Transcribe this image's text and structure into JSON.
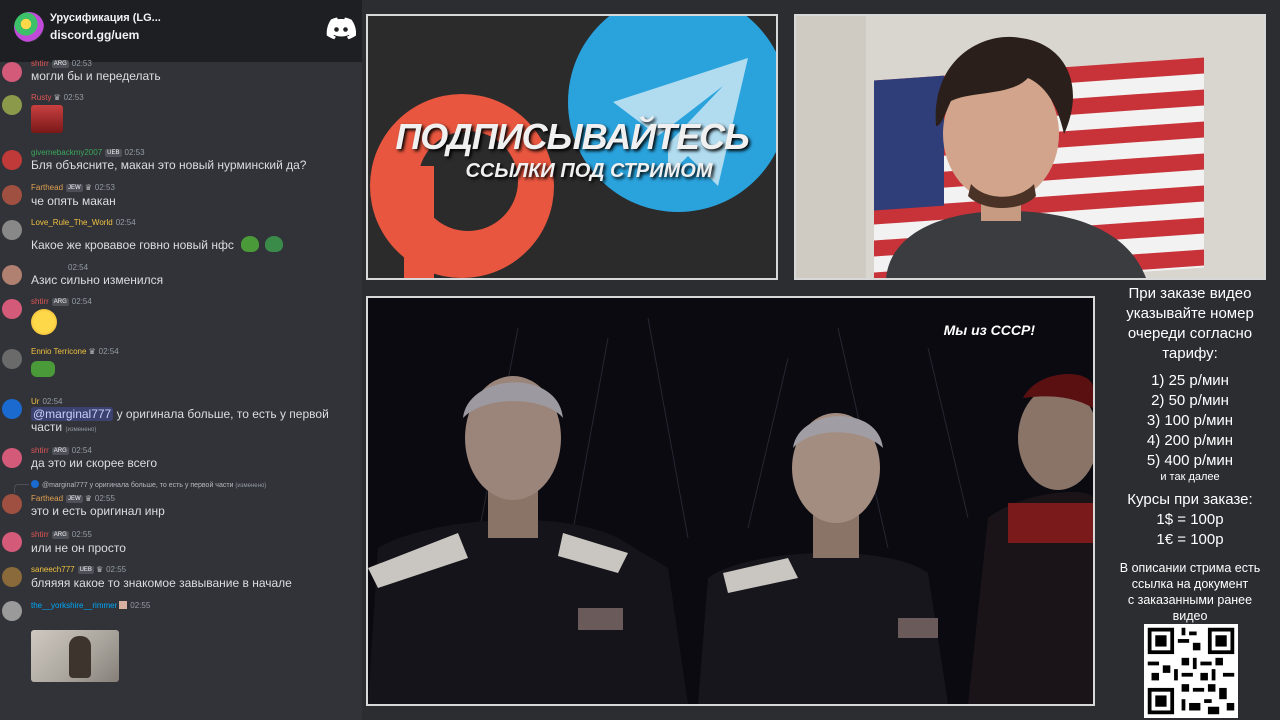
{
  "discord": {
    "server_name": "Урусификация (LG...",
    "invite": "discord.gg/uem",
    "messages": [
      {
        "author": "shtirr",
        "tag": "ARG",
        "time": "02:53",
        "text": "могли бы и переделать",
        "author_color": "#e05656"
      },
      {
        "author": "Rusty",
        "time": "02:53",
        "author_color": "#e05656"
      },
      {
        "author": "givemebackmy2007",
        "tag": "UEB",
        "time": "02:53",
        "text": "Бля объясните, макан это новый нурминский да?",
        "author_color": "#3ba55c"
      },
      {
        "author": "Farthead",
        "tag": "JEW",
        "time": "02:53",
        "text": "че опять макан",
        "author_color": "#e0a050"
      },
      {
        "author": "Love_Rule_The_World",
        "time": "02:54",
        "text": "Какое же кровавое говно новый нфс",
        "author_color": "#f0c040"
      },
      {
        "author": "",
        "time": "02:54",
        "text": "Азис сильно изменился",
        "author_color": "#dbdee1"
      },
      {
        "author": "shtirr",
        "tag": "ARG",
        "time": "02:54",
        "author_color": "#e05656"
      },
      {
        "author": "Ennio Terricone",
        "time": "02:54",
        "author_color": "#f0c040"
      },
      {
        "author": "Ur",
        "time": "02:54",
        "mention": "@marginal777",
        "text": " у оригинала больше, то есть у первой",
        "text2": "части",
        "edited": "(изменено)",
        "author_color": "#f0c040"
      },
      {
        "author": "shtirr",
        "tag": "ARG",
        "time": "02:54",
        "text": "да это ии скорее всего",
        "author_color": "#e05656"
      },
      {
        "reply_text": "@marginal777 у оригинала больше, то есть у первой части",
        "reply_edited": "(изменено)",
        "author": "Farthead",
        "tag": "JEW",
        "time": "02:55",
        "text": "это и есть оригинал инр",
        "author_color": "#e0a050"
      },
      {
        "author": "shtirr",
        "tag": "ARG",
        "time": "02:55",
        "text": "или не он просто",
        "author_color": "#e05656"
      },
      {
        "author": "saneech777",
        "tag": "UEB",
        "time": "02:55",
        "text": "бляяяя какое то знакомое завывание в начале",
        "author_color": "#f0c040"
      },
      {
        "author": "the__yorkshire__rimmer",
        "time": "02:55",
        "author_color": "#00a8fc"
      }
    ]
  },
  "promo": {
    "headline": "ПОДПИСЫВАЙТЕСЬ",
    "subheadline": "ССЫЛКИ ПОД СТРИМОМ"
  },
  "video": {
    "caption": "Мы из СССР!"
  },
  "info": {
    "order_lines": [
      "При заказе видео",
      "указывайте номер",
      "очереди согласно",
      "тарифу:"
    ],
    "tariffs": [
      "1) 25 р/мин",
      "2) 50 р/мин",
      "3) 100 р/мин",
      "4) 200 р/мин",
      "5) 400 р/мин"
    ],
    "etc": "и так далее",
    "rates_title": "Курсы при заказе:",
    "rates": [
      "1$ = 100р",
      "1€ = 100р"
    ],
    "desc_lines": [
      "В описании стрима есть",
      "ссылка на документ",
      "с заказанными ранее",
      "видео"
    ]
  },
  "colors": {
    "discord_bg": "#313338",
    "discord_header": "#1e1f22",
    "patreon": "#e8563f",
    "telegram": "#2aa3dd"
  }
}
